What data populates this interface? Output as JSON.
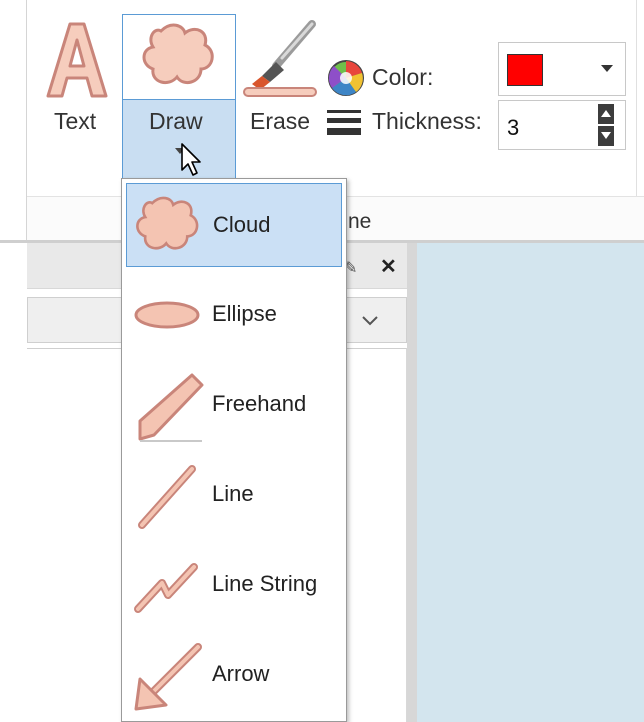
{
  "ribbon": {
    "tools": {
      "text_label": "Text",
      "draw_label": "Draw",
      "erase_label": "Erase"
    },
    "color": {
      "label": "Color:",
      "value": "#ff0000"
    },
    "thickness": {
      "label": "Thickness:",
      "value": "3"
    },
    "group_caption": "ne"
  },
  "draw_menu": {
    "items": [
      {
        "label": "Cloud",
        "icon": "cloud-icon",
        "selected": true
      },
      {
        "label": "Ellipse",
        "icon": "ellipse-icon",
        "selected": false
      },
      {
        "label": "Freehand",
        "icon": "freehand-icon",
        "selected": false
      },
      {
        "label": "Line",
        "icon": "line-icon",
        "selected": false
      },
      {
        "label": "Line String",
        "icon": "line-string-icon",
        "selected": false
      },
      {
        "label": "Arrow",
        "icon": "arrow-icon",
        "selected": false
      }
    ]
  },
  "colors": {
    "accent_border": "#5b9bd5",
    "selection_fill": "#cbe0f5",
    "icon_fill": "#f4c4b2",
    "icon_stroke": "#c9857a",
    "canvas": "#d3e5ee"
  }
}
